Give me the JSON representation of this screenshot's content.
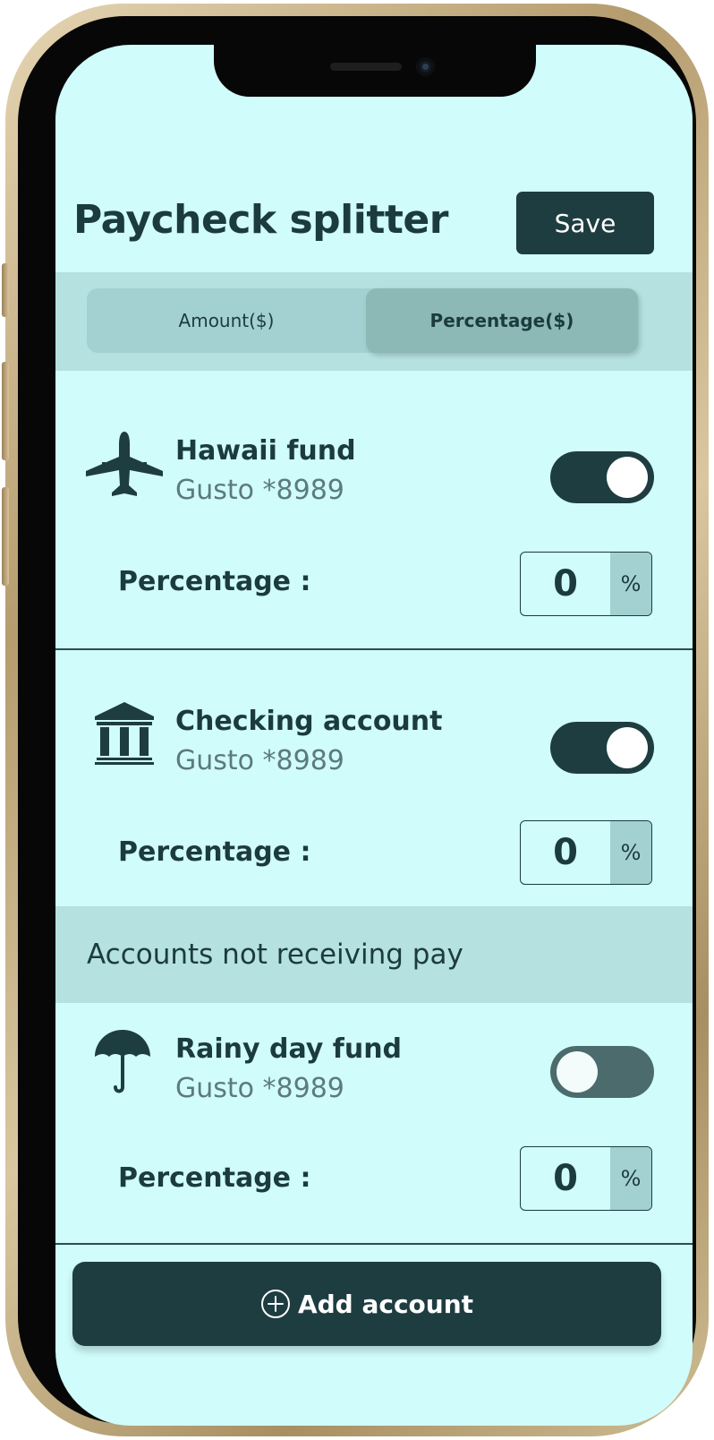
{
  "header": {
    "title": "Paycheck splitter",
    "save_label": "Save"
  },
  "tabs": [
    {
      "label": "Amount($)",
      "selected": false
    },
    {
      "label": "Percentage($)",
      "selected": true
    }
  ],
  "accounts": [
    {
      "name": "Hawaii fund",
      "sub": "Gusto *8989",
      "icon": "airplane-icon",
      "enabled": true,
      "percentage_label": "Percentage :",
      "percentage_value": "0",
      "unit": "%"
    },
    {
      "name": "Checking account",
      "sub": "Gusto *8989",
      "icon": "bank-icon",
      "enabled": true,
      "percentage_label": "Percentage :",
      "percentage_value": "0",
      "unit": "%"
    },
    {
      "name": "Rainy day fund",
      "sub": "Gusto *8989",
      "icon": "umbrella-icon",
      "enabled": false,
      "percentage_label": "Percentage :",
      "percentage_value": "0",
      "unit": "%"
    }
  ],
  "section_not_receiving": "Accounts not receiving pay",
  "add_account_label": "Add account",
  "colors": {
    "screen_bg": "#d0fcfb",
    "primary_dark": "#1e3d41",
    "band": "#b5e1e1",
    "segment_active": "#8cb8b6"
  }
}
